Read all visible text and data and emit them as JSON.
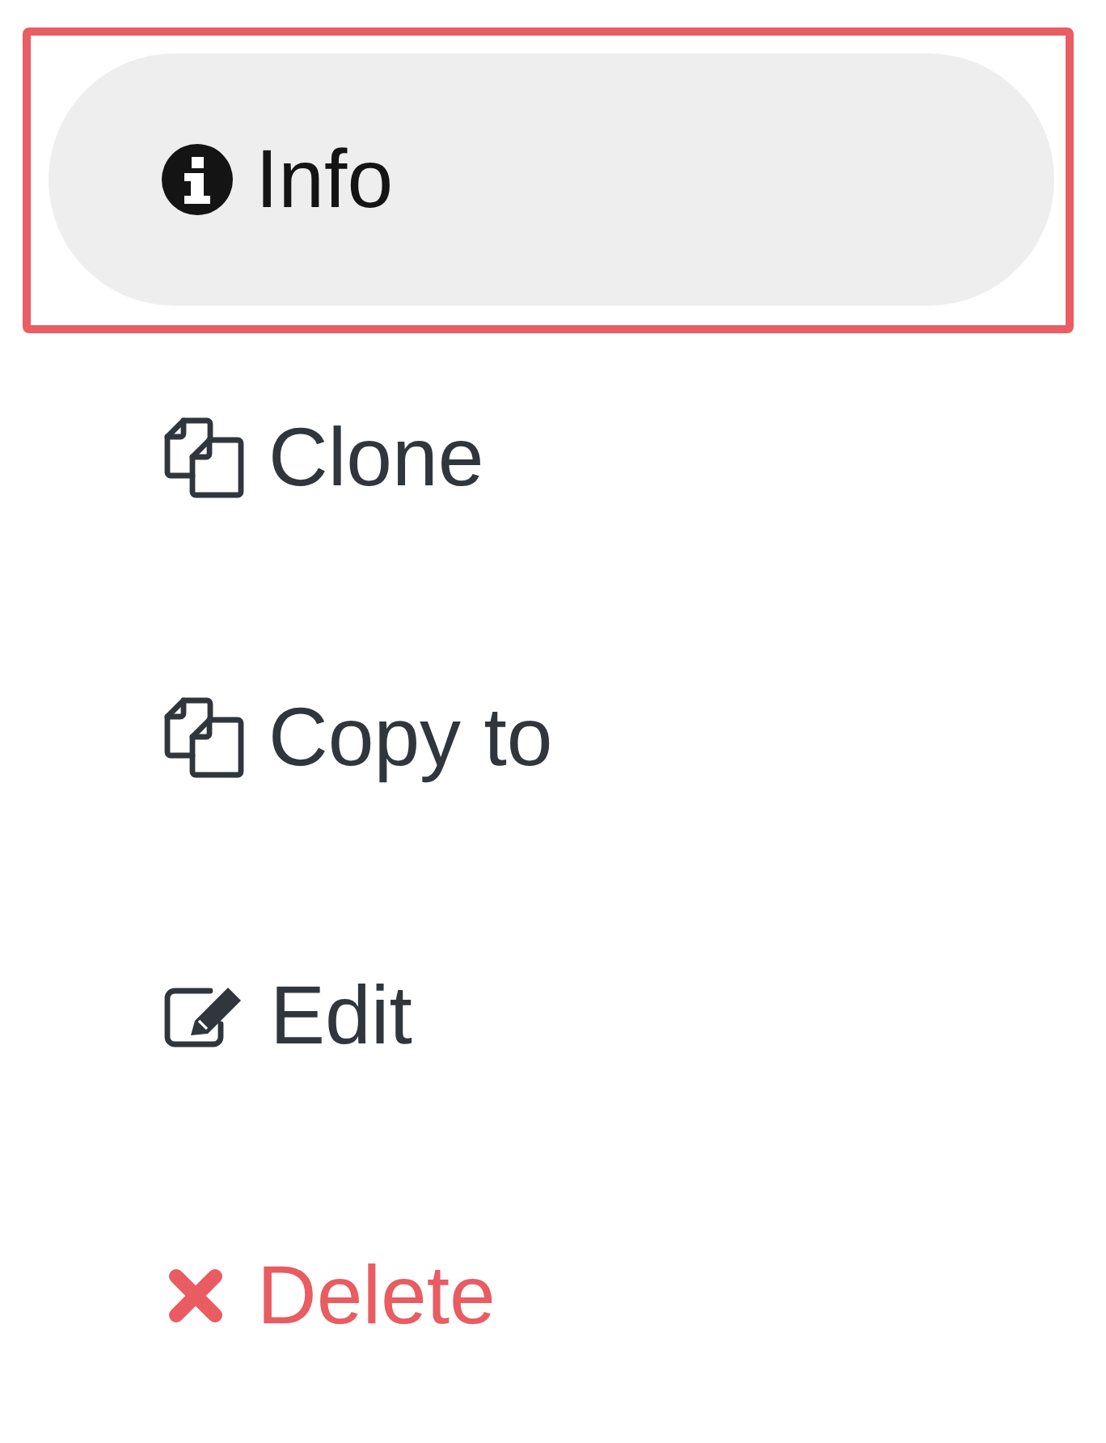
{
  "menu": {
    "items": [
      {
        "label": "Info",
        "kind": "default",
        "selected": true,
        "highlighted": true
      },
      {
        "label": "Clone",
        "kind": "default",
        "selected": false,
        "highlighted": false
      },
      {
        "label": "Copy to",
        "kind": "default",
        "selected": false,
        "highlighted": false
      },
      {
        "label": "Edit",
        "kind": "default",
        "selected": false,
        "highlighted": false
      },
      {
        "label": "Delete",
        "kind": "danger",
        "selected": false,
        "highlighted": false
      }
    ]
  }
}
